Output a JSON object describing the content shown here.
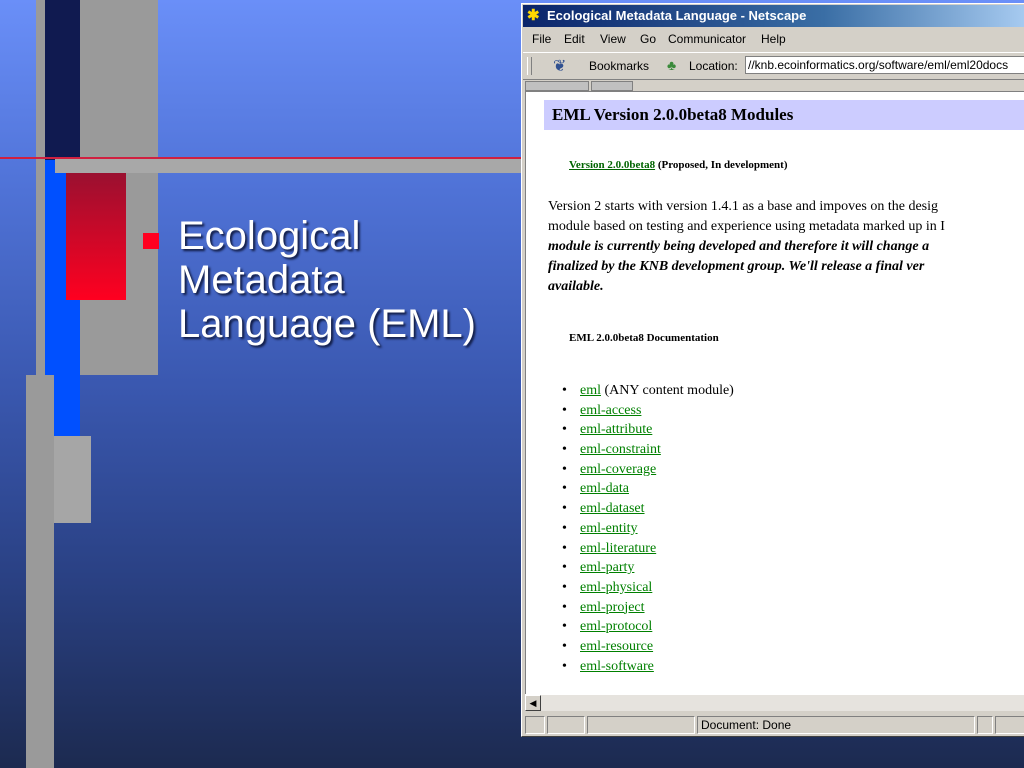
{
  "slide": {
    "bullet_text": "Ecological Metadata Language (EML)",
    "colors": {
      "background_top": "#6a8ff8",
      "background_bottom": "#1c2a50",
      "accent_red": "#ff0020",
      "accent_blue": "#0050ff"
    }
  },
  "browser": {
    "title": "Ecological Metadata Language - Netscape",
    "menus": [
      "File",
      "Edit",
      "View",
      "Go",
      "Communicator",
      "Help"
    ],
    "toolbar": {
      "bookmarks_label": "Bookmarks",
      "location_label": "Location:",
      "location_value": "//knb.ecoinformatics.org/software/eml/eml20docs"
    },
    "page": {
      "heading": "EML Version 2.0.0beta8 Modules",
      "version_link": "Version 2.0.0beta8",
      "version_note": " (Proposed, In development)",
      "para_line1": "Version 2 starts with version 1.4.1 as a base and impoves on the desig",
      "para_line2": "module based on testing and experience using metadata marked up in I",
      "para_line3": "module is currently being developed and therefore it will change a",
      "para_line4": "finalized by the KNB development group. We'll release a final ver",
      "para_line5": "available.",
      "doc_heading": "EML 2.0.0beta8 Documentation",
      "first_module_link": "eml",
      "first_module_note": " (ANY content module)",
      "modules": [
        "eml-access",
        "eml-attribute",
        "eml-constraint",
        "eml-coverage",
        "eml-data",
        "eml-dataset",
        "eml-entity",
        "eml-literature",
        "eml-party",
        "eml-physical",
        "eml-project",
        "eml-protocol",
        "eml-resource",
        "eml-software"
      ]
    },
    "status": "Document: Done",
    "link_color": "#008000"
  }
}
